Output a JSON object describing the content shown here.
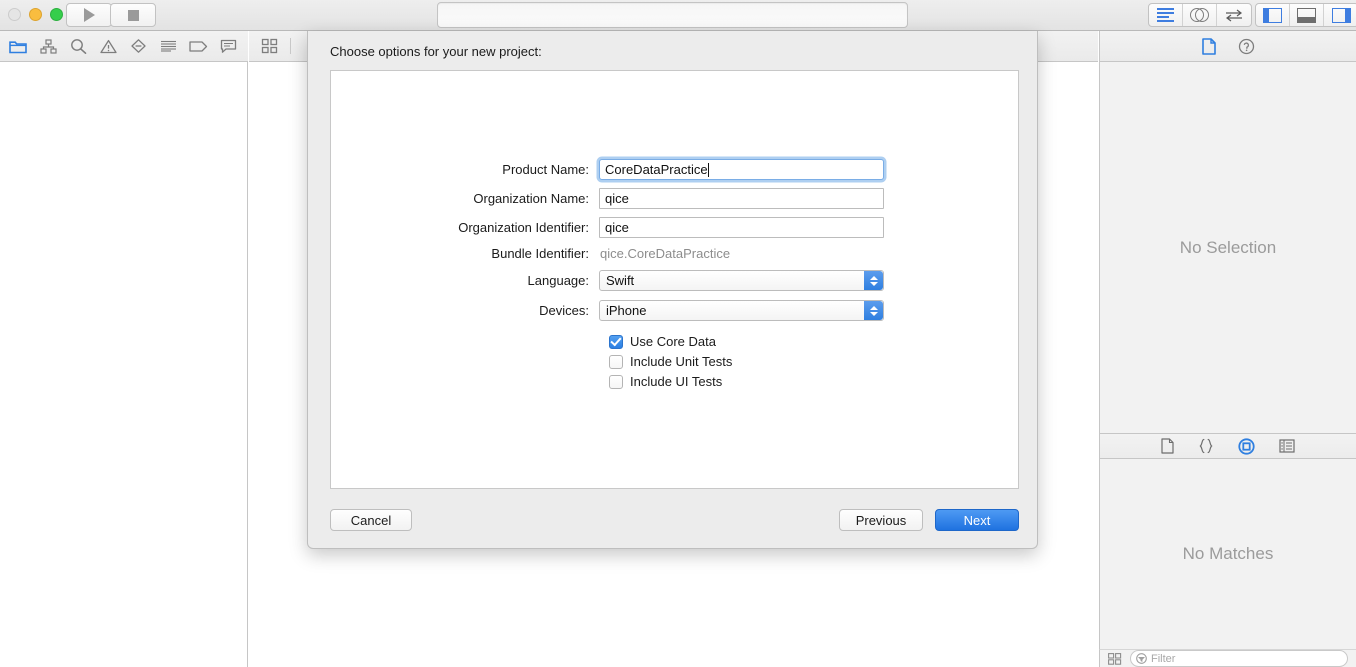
{
  "window": {
    "traffic_lights": [
      "close",
      "minimize",
      "zoom"
    ],
    "run_button": "run-icon",
    "stop_button": "stop-icon",
    "activity_viewer_text": "",
    "editor_mode_icons": [
      "standard-editor-icon",
      "assistant-editor-icon",
      "version-editor-icon"
    ],
    "pane_toggle_icons": [
      "navigator-pane-icon",
      "debug-pane-icon",
      "utilities-pane-icon"
    ]
  },
  "navigator": {
    "tabs": [
      {
        "name": "project-navigator",
        "icon": "folder-icon",
        "selected": true
      },
      {
        "name": "source-control-navigator",
        "icon": "source-control-icon",
        "selected": false
      },
      {
        "name": "find-navigator",
        "icon": "search-icon",
        "selected": false
      },
      {
        "name": "issue-navigator",
        "icon": "warning-triangle-icon",
        "selected": false
      },
      {
        "name": "test-navigator",
        "icon": "diamond-minus-icon",
        "selected": false
      },
      {
        "name": "debug-navigator",
        "icon": "debug-list-icon",
        "selected": false
      },
      {
        "name": "breakpoint-navigator",
        "icon": "breakpoint-tag-icon",
        "selected": false
      },
      {
        "name": "report-navigator",
        "icon": "speech-bubble-icon",
        "selected": false
      }
    ]
  },
  "editor": {
    "jump_bar_icons": [
      "related-items-icon",
      "back-chevron-icon"
    ]
  },
  "utilities": {
    "inspector_tabs": [
      {
        "name": "file-inspector",
        "icon": "document-icon",
        "selected": true
      },
      {
        "name": "quick-help-inspector",
        "icon": "question-circle-icon",
        "selected": false
      }
    ],
    "inspector_placeholder": "No Selection",
    "library_tabs": [
      {
        "name": "file-template-library",
        "icon": "document-icon",
        "selected": false
      },
      {
        "name": "code-snippet-library",
        "icon": "braces-icon",
        "selected": false
      },
      {
        "name": "object-library",
        "icon": "circled-square-icon",
        "selected": true
      },
      {
        "name": "media-library",
        "icon": "media-list-icon",
        "selected": false
      }
    ],
    "library_placeholder": "No Matches",
    "filter_placeholder": "Filter",
    "filter_value": "",
    "filter_icon": "filter-circle-icon",
    "view_toggle_icon": "grid-view-icon"
  },
  "sheet": {
    "title": "Choose options for your new project:",
    "fields": [
      {
        "label": "Product Name:",
        "value": "CoreDataPractice",
        "type": "text",
        "focused": true
      },
      {
        "label": "Organization Name:",
        "value": "qice",
        "type": "text",
        "focused": false
      },
      {
        "label": "Organization Identifier:",
        "value": "qice",
        "type": "text",
        "focused": false
      },
      {
        "label": "Bundle Identifier:",
        "value": "qice.CoreDataPractice",
        "type": "static",
        "focused": false
      },
      {
        "label": "Language:",
        "value": "Swift",
        "type": "popup",
        "focused": false
      },
      {
        "label": "Devices:",
        "value": "iPhone",
        "type": "popup",
        "focused": false
      }
    ],
    "checkboxes": [
      {
        "label": "Use Core Data",
        "checked": true
      },
      {
        "label": "Include Unit Tests",
        "checked": false
      },
      {
        "label": "Include UI Tests",
        "checked": false
      }
    ],
    "buttons": {
      "cancel": "Cancel",
      "previous": "Previous",
      "next": "Next"
    }
  },
  "colors": {
    "accent_blue": "#2f7fe0",
    "selected_icon_blue": "#2f7fe0",
    "placeholder_gray": "#9b9b9b",
    "sheet_bg": "#ececec"
  }
}
